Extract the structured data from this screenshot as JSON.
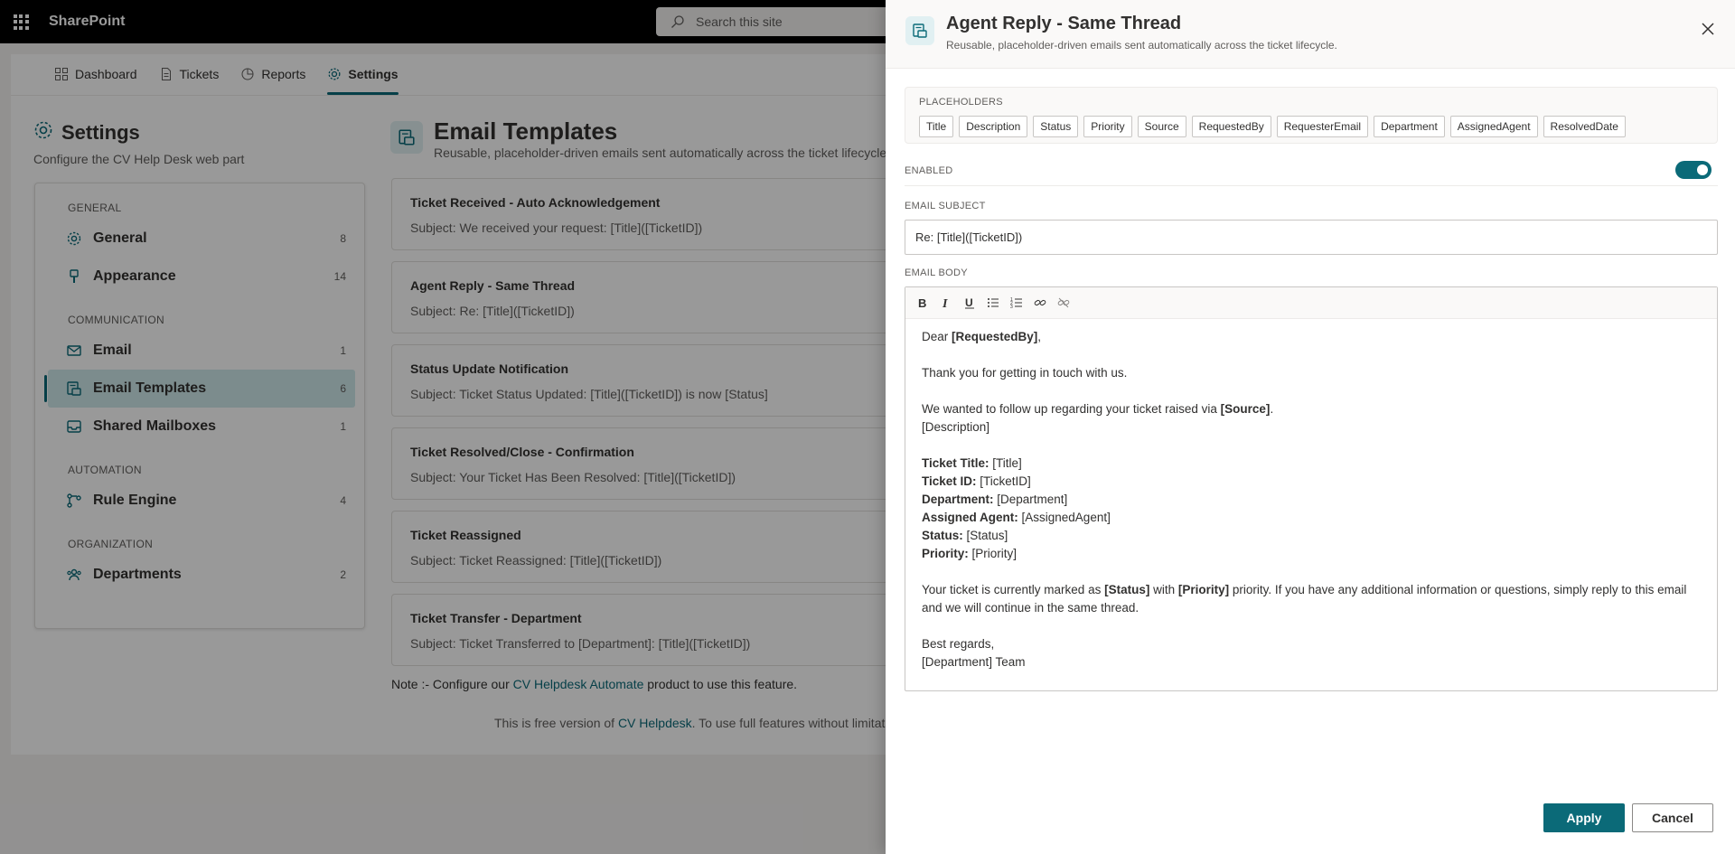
{
  "suitebar": {
    "brand": "SharePoint",
    "search_placeholder": "Search this site"
  },
  "topnav": [
    "Dashboard",
    "Tickets",
    "Reports",
    "Settings"
  ],
  "settings": {
    "title": "Settings",
    "subtitle": "Configure the CV Help Desk web part"
  },
  "sidebar": {
    "groups": [
      "GENERAL",
      "COMMUNICATION",
      "AUTOMATION",
      "ORGANIZATION"
    ],
    "items": [
      {
        "label": "General",
        "count": "8"
      },
      {
        "label": "Appearance",
        "count": "14"
      },
      {
        "label": "Email",
        "count": "1"
      },
      {
        "label": "Email Templates",
        "count": "6"
      },
      {
        "label": "Shared Mailboxes",
        "count": "1"
      },
      {
        "label": "Rule Engine",
        "count": "4"
      },
      {
        "label": "Departments",
        "count": "2"
      }
    ]
  },
  "email_templates": {
    "title": "Email Templates",
    "subtitle": "Reusable, placeholder-driven emails sent automatically across the ticket lifecycle.",
    "templates": [
      {
        "name": "Ticket Received - Auto Acknowledgement",
        "subject": "Subject: We received your request: [Title]([TicketID])"
      },
      {
        "name": "Agent Reply - Same Thread",
        "subject": "Subject: Re: [Title]([TicketID])"
      },
      {
        "name": "Status Update Notification",
        "subject": "Subject: Ticket Status Updated: [Title]([TicketID]) is now [Status]"
      },
      {
        "name": "Ticket Resolved/Close - Confirmation",
        "subject": "Subject: Your Ticket Has Been Resolved: [Title]([TicketID])"
      },
      {
        "name": "Ticket Reassigned",
        "subject": "Subject: Ticket Reassigned: [Title]([TicketID])"
      },
      {
        "name": "Ticket Transfer - Department",
        "subject": "Subject: Ticket Transferred to [Department]: [Title]([TicketID])"
      }
    ],
    "note_prefix": "Note :- Configure our ",
    "note_link": "CV Helpdesk Automate",
    "note_suffix": " product to use this feature.",
    "free_prefix": "This is free version of ",
    "free_link": "CV Helpdesk",
    "free_suffix": ". To use full features without limitations"
  },
  "panel": {
    "title": "Agent Reply - Same Thread",
    "subtitle": "Reusable, placeholder-driven emails sent automatically across the ticket lifecycle.",
    "placeholders_label": "PLACEHOLDERS",
    "placeholders": [
      "Title",
      "Description",
      "Status",
      "Priority",
      "Source",
      "RequestedBy",
      "RequesterEmail",
      "Department",
      "AssignedAgent",
      "ResolvedDate"
    ],
    "enabled_label": "ENABLED",
    "enabled": true,
    "subject_label": "EMAIL SUBJECT",
    "subject_value": "Re: [Title]([TicketID])",
    "body_label": "EMAIL BODY",
    "body": {
      "greet_prefix": "Dear ",
      "greet_bold": "[RequestedBy]",
      "greet_suffix": ",",
      "thanks": "Thank you for getting in touch with us.",
      "follow_prefix": "We wanted to follow up regarding your ticket raised via ",
      "follow_bold": "[Source]",
      "follow_suffix": ".",
      "description": "[Description]",
      "fields": [
        {
          "label": "Ticket Title:",
          "value": " [Title]"
        },
        {
          "label": "Ticket ID:",
          "value": " [TicketID]"
        },
        {
          "label": "Department:",
          "value": " [Department]"
        },
        {
          "label": "Assigned Agent:",
          "value": " [AssignedAgent]"
        },
        {
          "label": "Status:",
          "value": " [Status]"
        },
        {
          "label": "Priority:",
          "value": " [Priority]"
        }
      ],
      "closing_1": "Your ticket is currently marked as ",
      "closing_status": "[Status]",
      "closing_2": " with ",
      "closing_priority": "[Priority]",
      "closing_3": " priority. If you have any additional information or questions, simply reply to this email and we will continue in the same thread.",
      "regards": "Best regards,",
      "team": "[Department] Team"
    },
    "apply_label": "Apply",
    "cancel_label": "Cancel"
  },
  "colors": {
    "accent": "#0b6a78",
    "suitebar": "#000000"
  }
}
